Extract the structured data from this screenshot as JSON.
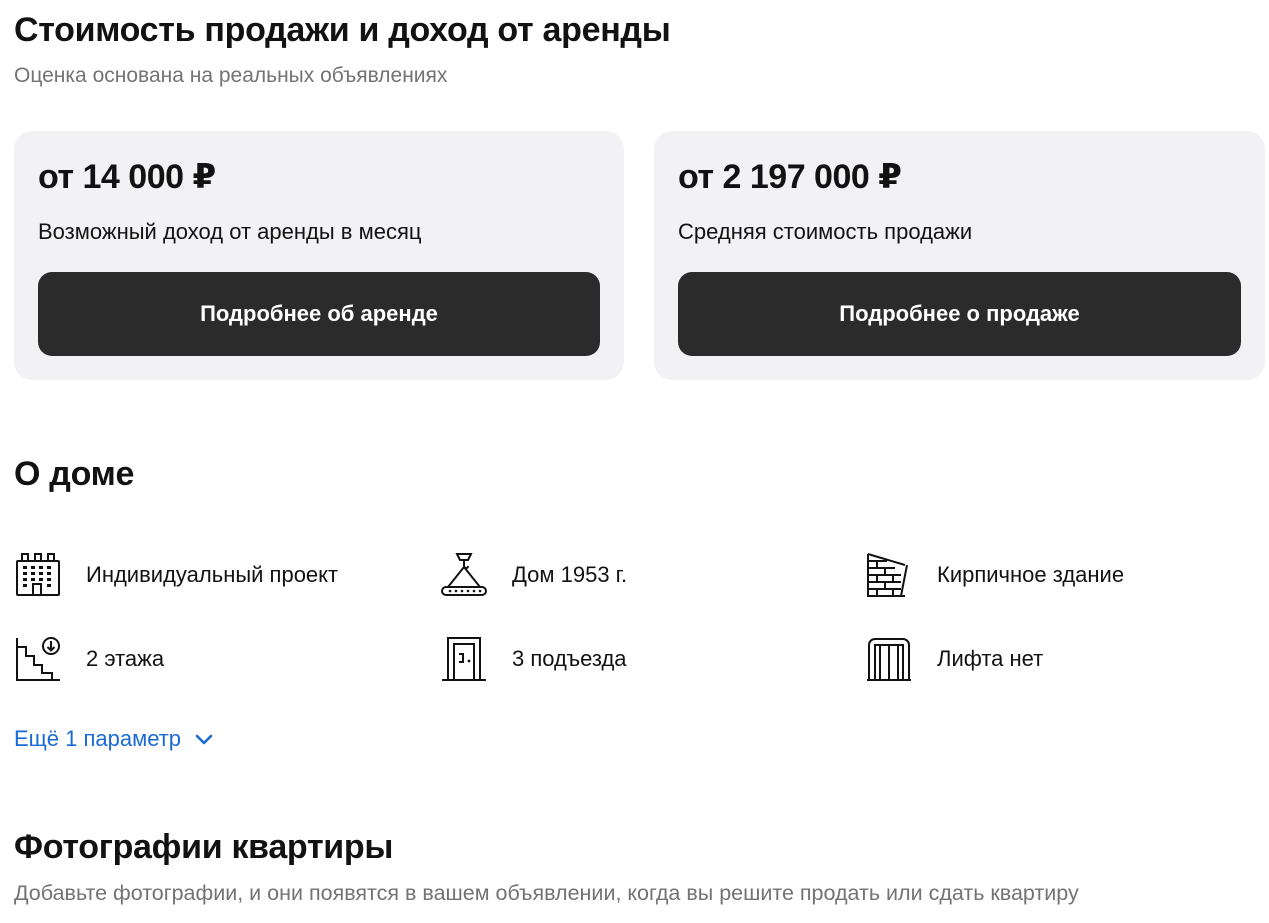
{
  "valuation": {
    "title": "Стоимость продажи и доход от аренды",
    "subtitle": "Оценка основана на реальных объявлениях",
    "rent": {
      "price": "от 14 000 ₽",
      "caption": "Возможный доход от аренды в месяц",
      "button_label": "Подробнее об аренде"
    },
    "sale": {
      "price": "от 2 197 000 ₽",
      "caption": "Средняя стоимость продажи",
      "button_label": "Подробнее о продаже"
    }
  },
  "house": {
    "title": "О доме",
    "features": [
      {
        "icon": "building-icon",
        "label": "Индивидуальный проект"
      },
      {
        "icon": "crane-hook-icon",
        "label": "Дом 1953 г."
      },
      {
        "icon": "brick-wall-icon",
        "label": "Кирпичное здание"
      },
      {
        "icon": "stairs-icon",
        "label": "2 этажа"
      },
      {
        "icon": "door-icon",
        "label": "3 подъезда"
      },
      {
        "icon": "elevator-icon",
        "label": "Лифта нет"
      }
    ],
    "more_label": "Ещё 1 параметр"
  },
  "photos": {
    "title": "Фотографии квартиры",
    "subtitle": "Добавьте фотографии, и они появятся в вашем объявлении, когда вы решите продать или сдать квартиру"
  },
  "colors": {
    "card_bg": "#f2f2f4",
    "button_bg": "#2b2b2b",
    "link": "#1a6ad5",
    "muted_text": "#737373"
  }
}
